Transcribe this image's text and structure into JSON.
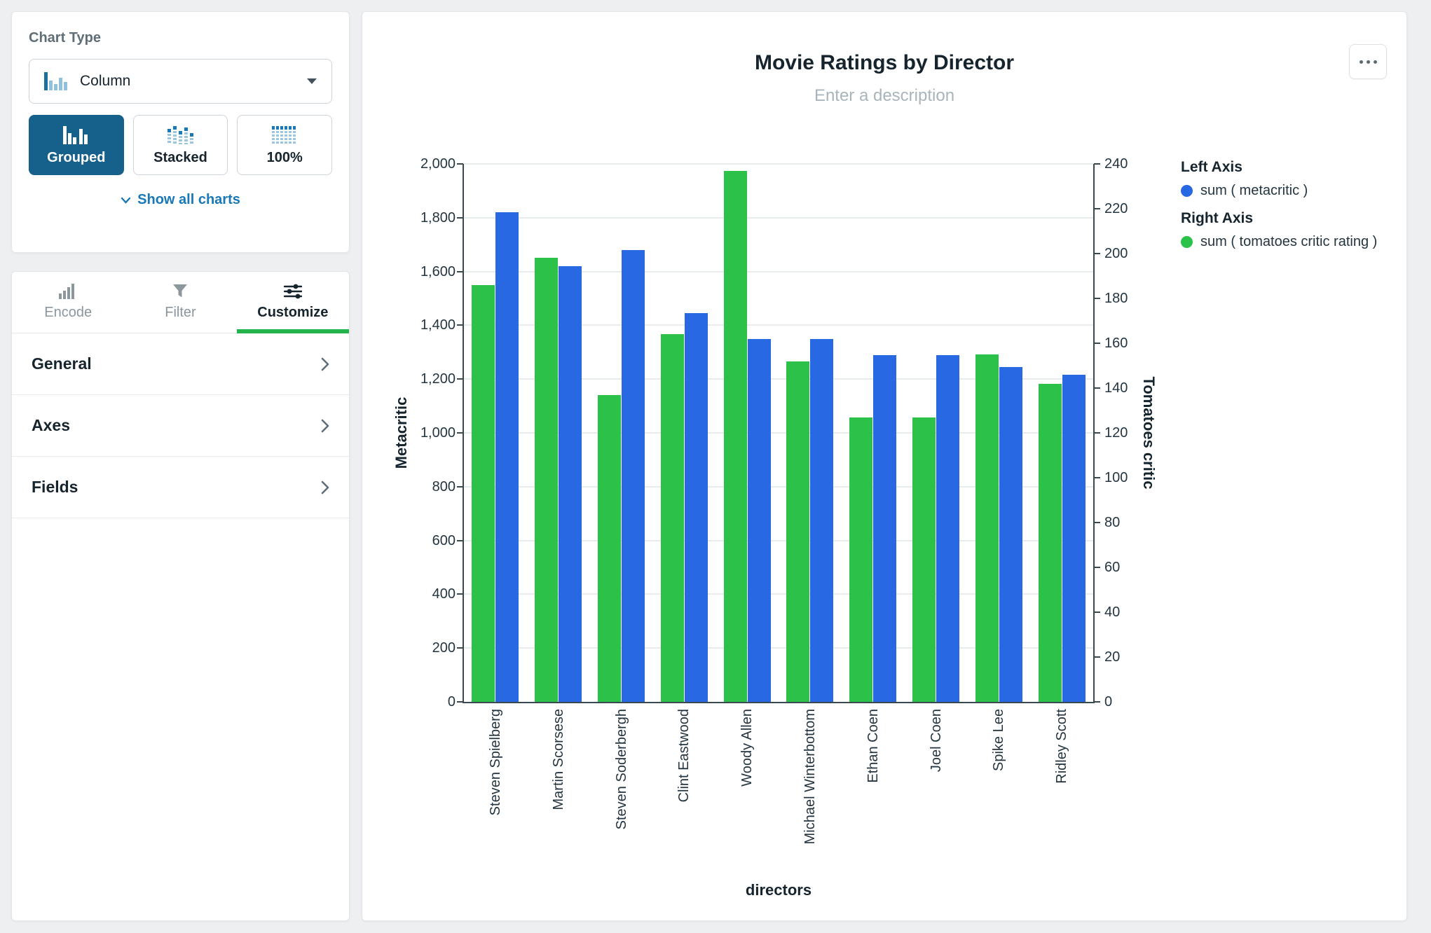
{
  "sidebar": {
    "chart_type_panel": {
      "title": "Chart Type",
      "selected_type": "Column",
      "modes": [
        {
          "label": "Grouped",
          "active": true
        },
        {
          "label": "Stacked",
          "active": false
        },
        {
          "label": "100%",
          "active": false
        }
      ],
      "show_all_charts_label": "Show all charts"
    },
    "tabs": [
      {
        "label": "Encode",
        "active": false
      },
      {
        "label": "Filter",
        "active": false
      },
      {
        "label": "Customize",
        "active": true
      }
    ],
    "sections": [
      "General",
      "Axes",
      "Fields"
    ]
  },
  "chart": {
    "title": "Movie Ratings by Director",
    "description_placeholder": "Enter a description",
    "legend": {
      "left_axis_title": "Left Axis",
      "left_series_label": "sum ( metacritic )",
      "right_axis_title": "Right Axis",
      "right_series_label": "sum ( tomatoes critic rating )"
    }
  },
  "chart_data": {
    "type": "bar",
    "bar_mode": "grouped",
    "title": "Movie Ratings by Director",
    "xlabel": "directors",
    "ylabel_left": "Metacritic",
    "ylabel_right": "Tomatoes critic",
    "categories": [
      "Steven Spielberg",
      "Martin Scorsese",
      "Steven Soderbergh",
      "Clint Eastwood",
      "Woody Allen",
      "Michael Winterbottom",
      "Ethan Coen",
      "Joel Coen",
      "Spike Lee",
      "Ridley Scott"
    ],
    "series": [
      {
        "name": "sum ( metacritic )",
        "axis": "left",
        "color": "#2968e3",
        "values": [
          1820,
          1620,
          1680,
          1445,
          1350,
          1350,
          1290,
          1290,
          1245,
          1215
        ]
      },
      {
        "name": "sum ( tomatoes critic rating )",
        "axis": "right",
        "color": "#2cc249",
        "values": [
          186,
          198,
          137,
          164,
          237,
          152,
          127,
          127,
          155,
          142
        ]
      }
    ],
    "left_axis": {
      "min": 0,
      "max": 2000,
      "step": 200
    },
    "right_axis": {
      "min": 0,
      "max": 240,
      "step": 20
    },
    "grid": true,
    "legend_position": "right"
  },
  "colors": {
    "bar_blue": "#2968e3",
    "bar_green": "#2cc249",
    "active_mode_bg": "#15618c",
    "link_blue": "#1878b8",
    "tab_active_underline": "#24b44b"
  }
}
